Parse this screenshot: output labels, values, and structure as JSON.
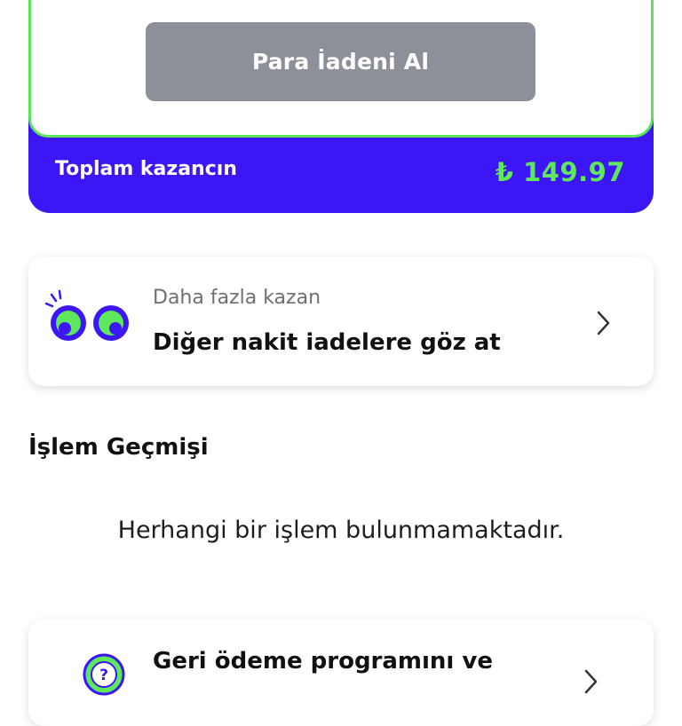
{
  "wallet": {
    "refund_button": "Para İadeni Al",
    "total_label": "Toplam kazancın",
    "total_value": "₺ 149.97"
  },
  "earn_more": {
    "subtitle": "Daha fazla kazan",
    "title": "Diğer nakit iadelere göz at",
    "icon": "eyes-icon"
  },
  "history": {
    "title": "İşlem Geçmişi",
    "empty_message": "Herhangi bir işlem bulunmamaktadır."
  },
  "help": {
    "title": "Geri ödeme programını ve",
    "icon": "question-icon"
  },
  "colors": {
    "brand_purple": "#3c16f5",
    "accent_green": "#5ee85c",
    "button_gray": "#8d9099"
  }
}
